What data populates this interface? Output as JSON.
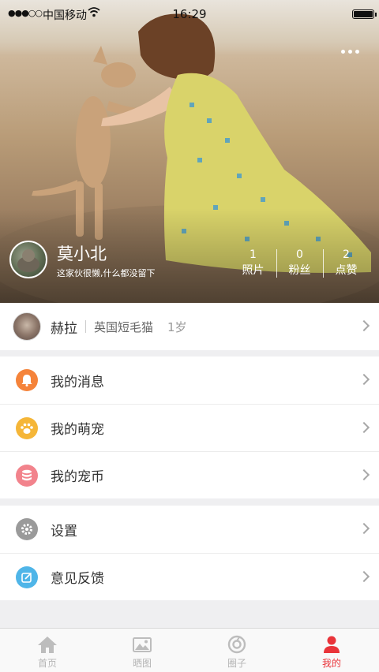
{
  "status_bar": {
    "signal": "●●●○○",
    "carrier": "中国移动",
    "time": "16:29"
  },
  "profile": {
    "name": "莫小北",
    "bio": "这家伙很懒,什么都没留下",
    "stats": [
      {
        "value": "1",
        "label": "照片"
      },
      {
        "value": "0",
        "label": "粉丝"
      },
      {
        "value": "2",
        "label": "点赞"
      }
    ]
  },
  "pet": {
    "name": "赫拉",
    "breed": "英国短毛猫",
    "age": "1岁"
  },
  "menu": {
    "group1": [
      {
        "label": "我的消息",
        "icon": "bell-icon",
        "color": "#f5833a"
      },
      {
        "label": "我的萌宠",
        "icon": "paw-icon",
        "color": "#f5b638"
      },
      {
        "label": "我的宠币",
        "icon": "coins-icon",
        "color": "#f2838c"
      }
    ],
    "group2": [
      {
        "label": "设置",
        "icon": "gear-icon",
        "color": "#9a9a9a"
      },
      {
        "label": "意见反馈",
        "icon": "feedback-icon",
        "color": "#4fb5e8"
      }
    ]
  },
  "tabbar": {
    "tabs": [
      {
        "label": "首页",
        "icon": "home-icon"
      },
      {
        "label": "晒图",
        "icon": "image-icon"
      },
      {
        "label": "圈子",
        "icon": "circle-icon"
      },
      {
        "label": "我的",
        "icon": "user-icon",
        "active": true
      }
    ],
    "active_color": "#e9343a"
  }
}
